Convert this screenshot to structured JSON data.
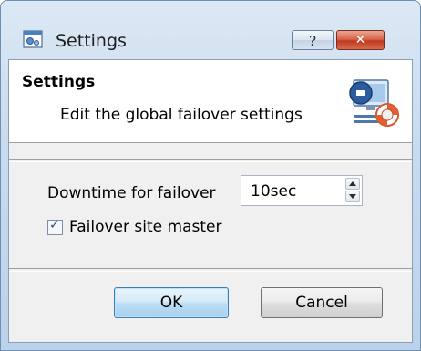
{
  "window": {
    "title": "Settings",
    "help_label": "?",
    "close_label": "✕"
  },
  "header": {
    "title": "Settings",
    "subtitle": "Edit the global failover settings"
  },
  "form": {
    "downtime_label": "Downtime for failover",
    "downtime_value": "10sec",
    "failover_master_label": "Failover site master",
    "failover_master_checked": true
  },
  "buttons": {
    "ok": "OK",
    "cancel": "Cancel"
  },
  "icons": {
    "app": "settings-app-icon",
    "header": "failover-lifebuoy-icon"
  }
}
